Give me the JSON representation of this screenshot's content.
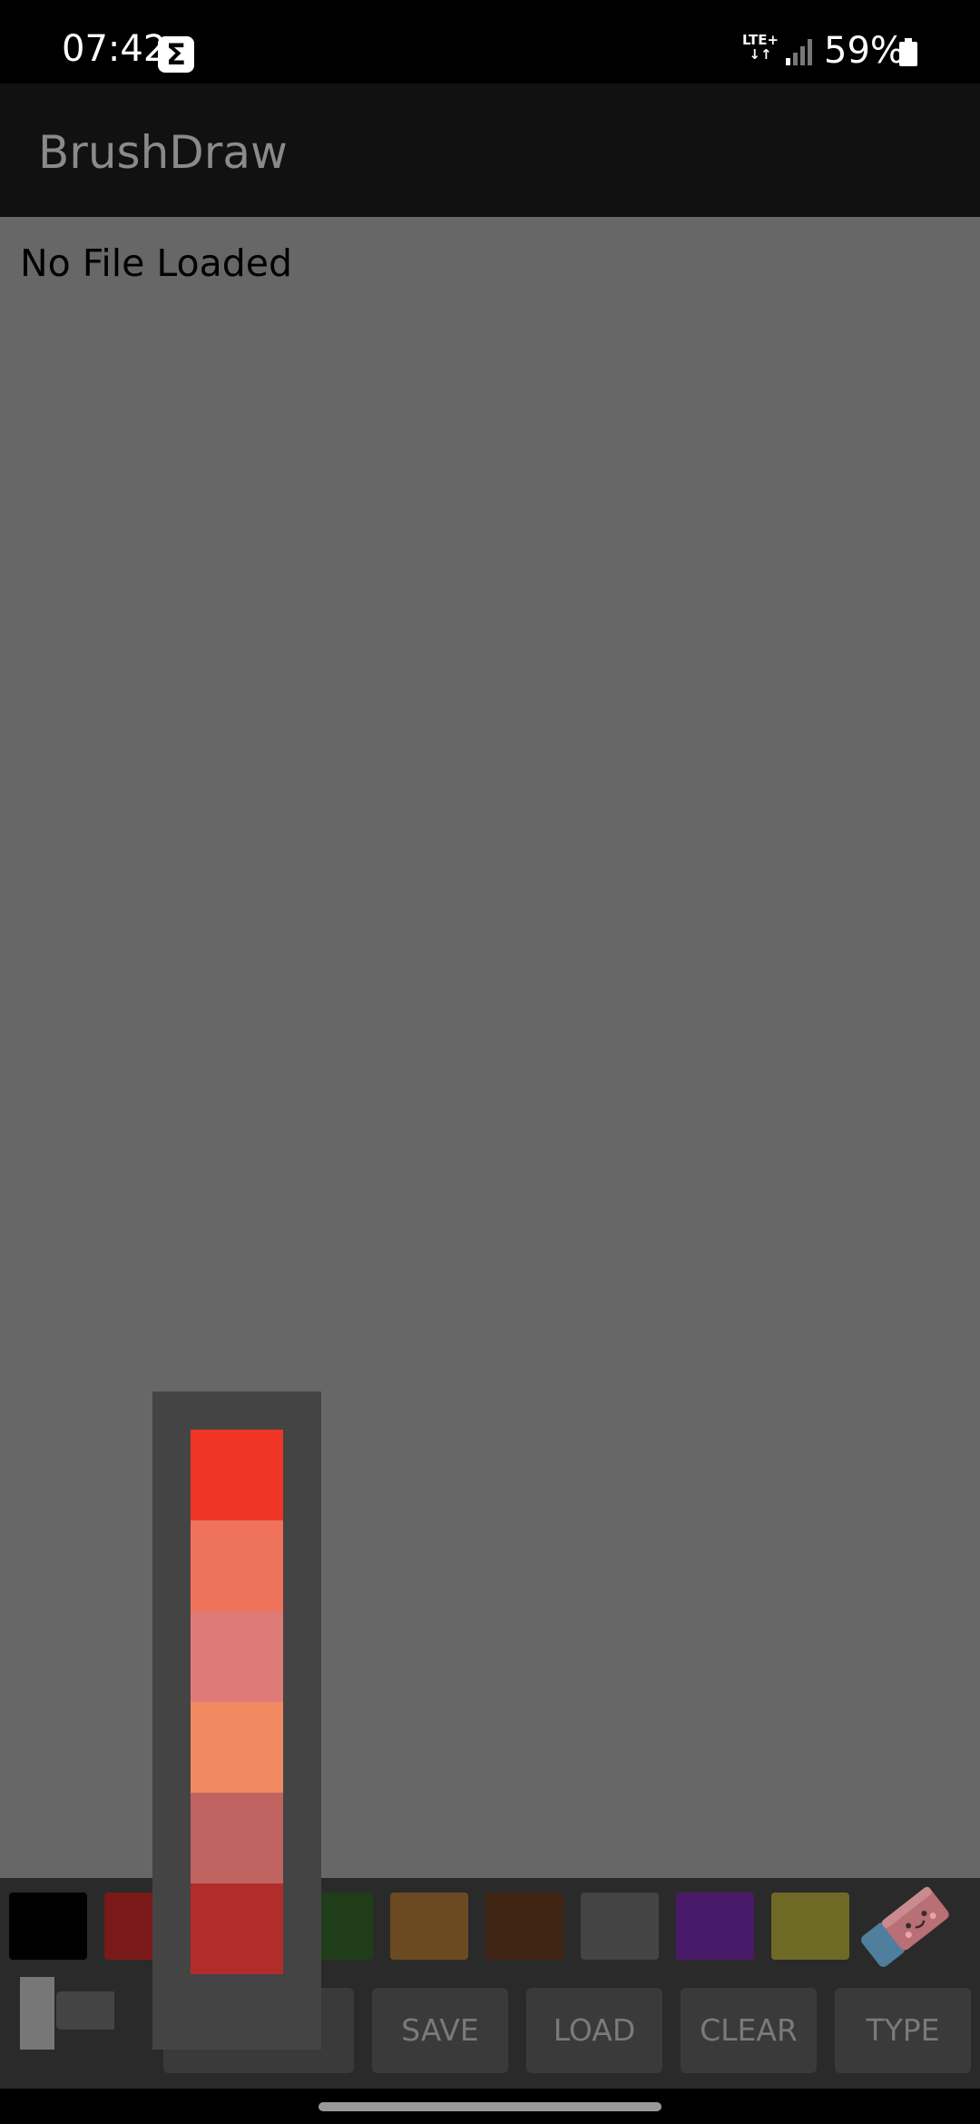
{
  "status_bar": {
    "time": "07:42",
    "notification_icon": "sigma-icon",
    "network": "LTE+",
    "battery_percent": "59%"
  },
  "app": {
    "title": "BrushDraw"
  },
  "canvas": {
    "file_status": "No File Loaded",
    "background_color": "#676767"
  },
  "palette": {
    "swatches": [
      {
        "name": "black",
        "color": "#000000"
      },
      {
        "name": "dark-red",
        "color": "#7a1a18"
      },
      {
        "name": "dark-green",
        "color": "#1f3d18"
      },
      {
        "name": "brown-orange",
        "color": "#6b4a22"
      },
      {
        "name": "dark-brown",
        "color": "#3f2313"
      },
      {
        "name": "dark-gray",
        "color": "#444444"
      },
      {
        "name": "purple",
        "color": "#4a1a6a"
      },
      {
        "name": "olive",
        "color": "#6e6a25"
      }
    ],
    "eraser_icon": "eraser-icon"
  },
  "color_popup": {
    "colors": [
      "#ef3526",
      "#ef725a",
      "#de7b78",
      "#f18a60",
      "#c06461",
      "#b12d2c"
    ]
  },
  "buttons": {
    "save": "SAVE",
    "load": "LOAD",
    "clear": "CLEAR",
    "type": "TYPE"
  }
}
